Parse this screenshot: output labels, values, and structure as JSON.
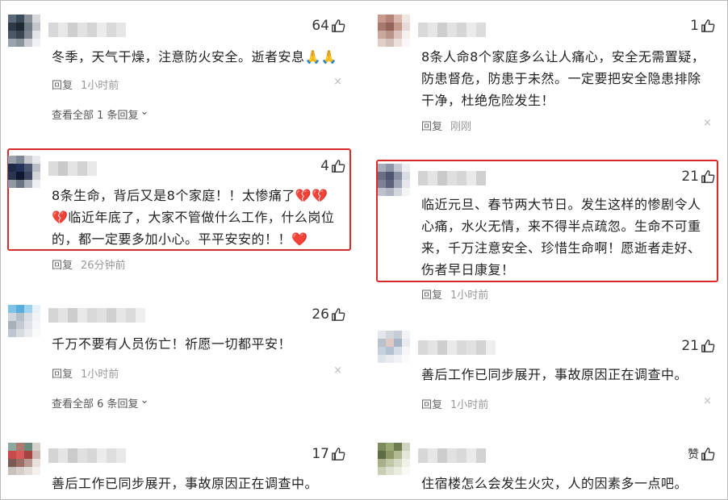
{
  "left": [
    {
      "likes": "64",
      "text": "冬季，天气干燥，注意防火安全。逝者安息🙏🙏",
      "reply": "回复",
      "time": "1小时前",
      "expand": "查看全部 1 条回复"
    },
    {
      "likes": "4",
      "text_parts": [
        "8条生命，背后又是8个家庭！！太惨痛了",
        "💔💔",
        "💔",
        "临近年底了，大家不管做什么工作，什么岗位的，都一定要多加小心。平平安安的！！",
        "❤️"
      ],
      "reply": "回复",
      "time": "26分钟前"
    },
    {
      "likes": "26",
      "text": "千万不要有人员伤亡！祈愿一切都平安！",
      "reply": "回复",
      "time": "1小时前",
      "expand": "查看全部 6 条回复"
    },
    {
      "likes": "17",
      "text": "善后工作已同步展开，事故原因正在调查中。"
    }
  ],
  "right": [
    {
      "likes": "1",
      "text": "8条人命8个家庭多么让人痛心，安全无需置疑，防患督危，防患于未然。一定要把安全隐患排除干净，杜绝危险发生！",
      "reply": "回复",
      "time": "刚刚"
    },
    {
      "likes": "21",
      "text": "临近元旦、春节两大节日。发生这样的惨剧令人心痛，水火无情，来不得半点疏忽。生命不可重来，千万注意安全、珍惜生命啊！愿逝者走好、伤者早日康复！",
      "reply": "回复",
      "time": "1小时前"
    },
    {
      "likes": "21",
      "text": "善后工作已同步展开，事故原因正在调查中。",
      "reply": "回复",
      "time": "1小时前"
    },
    {
      "likes": "赞",
      "text": "住宿楼怎么会发生火灾，人的因素多一点吧。"
    }
  ],
  "close_glyph": "×",
  "expand_glyph": "⌄",
  "colors": {
    "highlight": "#d82c2c",
    "heart": "#e02a2a"
  }
}
